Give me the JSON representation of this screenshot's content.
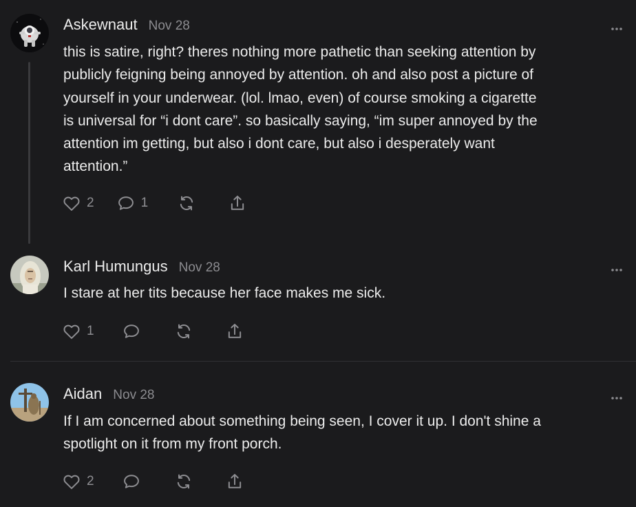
{
  "comments": [
    {
      "author": "Askewnaut",
      "date": "Nov 28",
      "avatar_icon": "astronaut-avatar",
      "body_lines": [
        "this is satire, right? theres nothing more pathetic than seeking attention by",
        "publicly feigning being annoyed by attention. oh and also post a picture of",
        "yourself in your underwear. (lol. lmao, even) of course smoking a cigarette",
        "is universal for “i dont care”. so basically saying, “im super annoyed by the",
        "attention im getting, but also i dont care, but also i desperately want",
        "attention.”"
      ],
      "likes": "2",
      "replies": "1"
    },
    {
      "author": "Karl Humungus",
      "date": "Nov 28",
      "avatar_icon": "person-photo-avatar",
      "body_lines": [
        "I stare at her tits because her face makes me sick."
      ],
      "likes": "1",
      "replies": ""
    },
    {
      "author": "Aidan",
      "date": "Nov 28",
      "avatar_icon": "statue-photo-avatar",
      "body_lines": [
        "If I am concerned about something being seen, I cover it up. I don't shine a",
        "spotlight on it from my front porch."
      ],
      "likes": "2",
      "replies": ""
    }
  ],
  "icons": {
    "like": "heart-icon",
    "reply": "speech-bubble-icon",
    "restack": "restack-icon",
    "share": "share-icon",
    "more": "more-dots-icon"
  },
  "colors": {
    "background": "#1b1b1d",
    "text": "#ececec",
    "muted": "#8c8c90",
    "thread_line": "#3a3a3d"
  }
}
